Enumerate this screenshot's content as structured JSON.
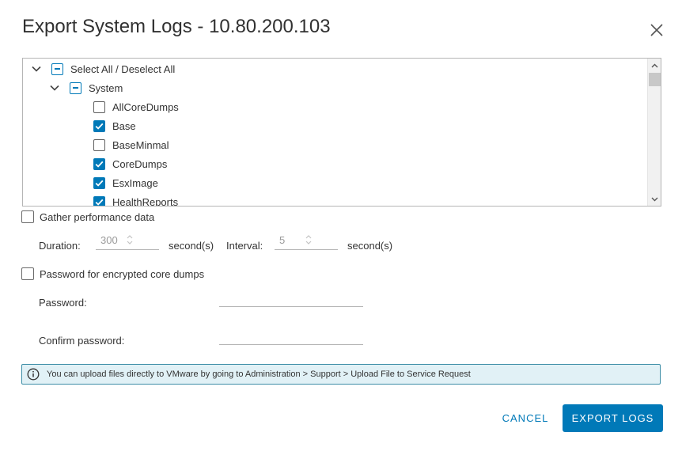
{
  "dialog": {
    "title": "Export System Logs - 10.80.200.103"
  },
  "tree": {
    "root_label": "Select All / Deselect All",
    "group_label": "System",
    "items": [
      {
        "label": "AllCoreDumps",
        "checked": false
      },
      {
        "label": "Base",
        "checked": true
      },
      {
        "label": "BaseMinmal",
        "checked": false
      },
      {
        "label": "CoreDumps",
        "checked": true
      },
      {
        "label": "EsxImage",
        "checked": true
      },
      {
        "label": "HealthReports",
        "checked": true
      }
    ]
  },
  "performance": {
    "label": "Gather performance data",
    "duration_label": "Duration:",
    "duration_value": "300",
    "duration_unit": "second(s)",
    "interval_label": "Interval:",
    "interval_value": "5",
    "interval_unit": "second(s)"
  },
  "password_section": {
    "label": "Password for encrypted core dumps",
    "password_label": "Password:",
    "confirm_label": "Confirm password:"
  },
  "info": {
    "text": "You can upload files directly to VMware by going to Administration > Support > Upload File to Service Request"
  },
  "buttons": {
    "cancel": "CANCEL",
    "export": "EXPORT LOGS"
  },
  "colors": {
    "accent": "#0079b8",
    "info_border": "#3d8ea7",
    "info_bg": "#e1f1f6"
  }
}
